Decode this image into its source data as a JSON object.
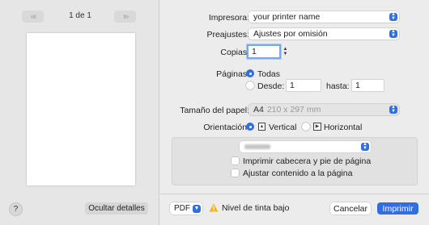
{
  "preview": {
    "first_icon": "«‹",
    "prev_icon": "‹",
    "next_icon": "›",
    "last_icon": "›»",
    "page_indicator": "1 de 1",
    "help_label": "?",
    "hide_details_label": "Ocultar detalles"
  },
  "settings": {
    "printer_label": "Impresora:",
    "printer_value": "your printer name",
    "presets_label": "Preajustes:",
    "presets_value": "Ajustes por omisión",
    "copies_label": "Copias:",
    "copies_value": "1",
    "pages_label": "Páginas:",
    "pages_all_label": "Todas",
    "pages_all_selected": true,
    "pages_from_label": "Desde:",
    "pages_from_value": "1",
    "pages_to_label": "hasta:",
    "pages_to_value": "1",
    "paper_size_label": "Tamaño del papel:",
    "paper_size_value": "A4",
    "paper_size_dims": "210 x 297 mm",
    "orientation_label": "Orientación:",
    "orientation_vertical_label": "Vertical",
    "orientation_horizontal_label": "Horizontal",
    "orientation_selected": "Vertical"
  },
  "app_section": {
    "header_footer_label": "Imprimir cabecera y pie de página",
    "header_footer_checked": false,
    "fit_content_label": "Ajustar contenido a la página",
    "fit_content_checked": false
  },
  "bottom": {
    "pdf_label": "PDF",
    "ink_warning": "Nivel de tinta bajo",
    "cancel_label": "Cancelar",
    "print_label": "Imprimir"
  },
  "colors": {
    "accent": "#2f6fde",
    "warning": "#f3b319"
  }
}
